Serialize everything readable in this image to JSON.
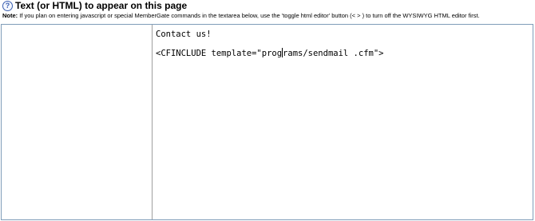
{
  "header": {
    "help_icon_glyph": "?",
    "title": "Text (or HTML) to appear on this page",
    "note_label": "Note:",
    "note_text": " If you plan on entering javascript or special MemberGate commands in the textarea below, use the 'toggle html editor' button (< > ) to turn off the WYSIWYG HTML editor first."
  },
  "editor": {
    "line1": "Contact us!",
    "line2_before_caret": "<CFINCLUDE template=\"prog",
    "line2_after_caret": "rams/sendmail .cfm\">"
  }
}
